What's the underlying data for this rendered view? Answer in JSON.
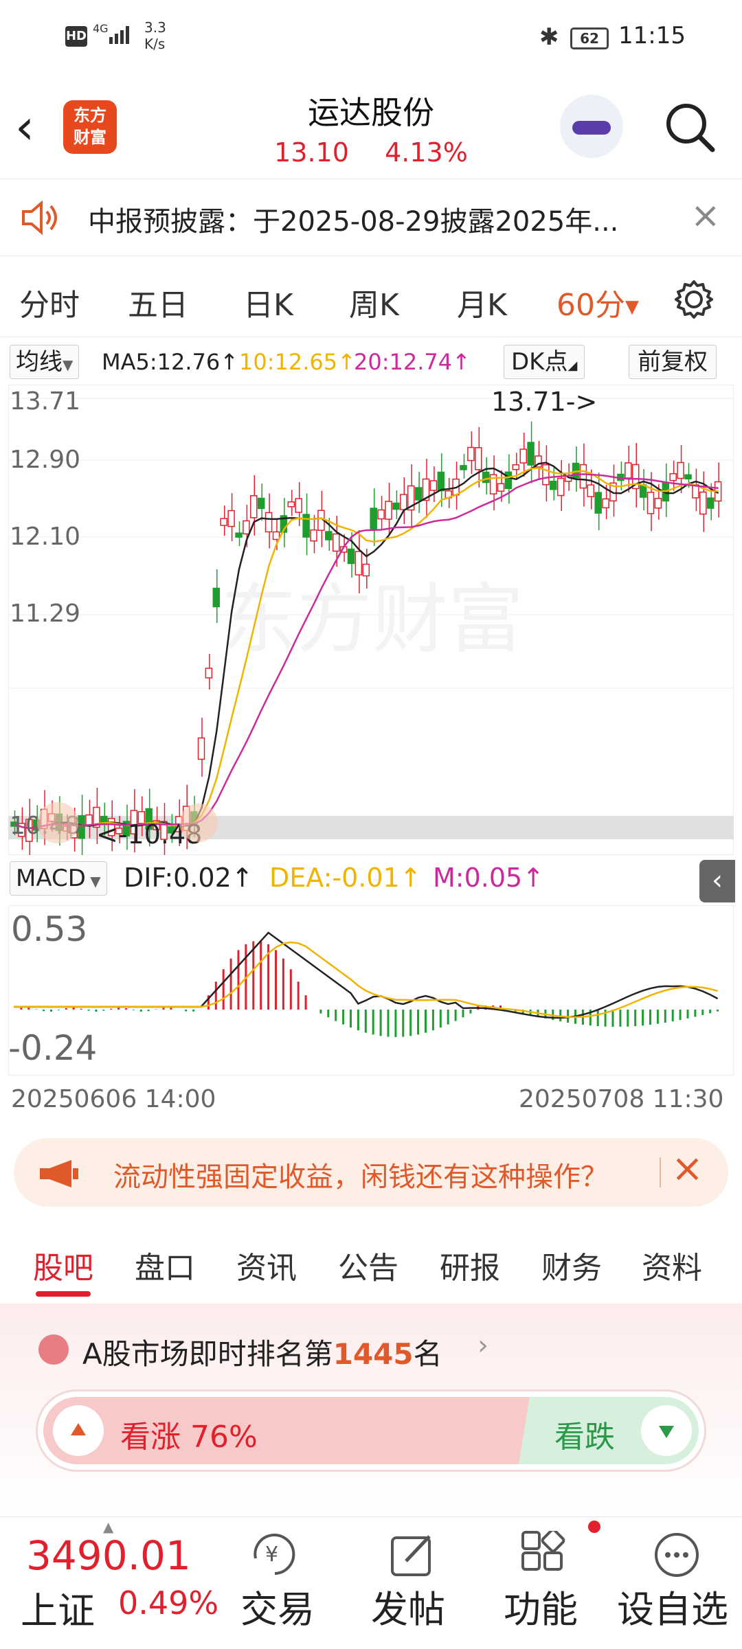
{
  "status_bar": {
    "hd": "HD",
    "network": "4G",
    "speed_value": "3.3",
    "speed_unit": "K/s",
    "battery": "62",
    "time": "11:15"
  },
  "header": {
    "logo_line1": "东方",
    "logo_line2": "财富",
    "title": "运达股份",
    "price": "13.10",
    "change": "4.13%"
  },
  "notice": {
    "text": "中报预披露：于2025-08-29披露2025年..."
  },
  "tabs": [
    "分时",
    "五日",
    "日K",
    "周K",
    "月K",
    "60分"
  ],
  "indicator_bar": {
    "selector": "均线",
    "ma5": "MA5:12.76↑",
    "ma10": "10:12.65↑",
    "ma20": "20:12.74↑",
    "dk": "DK点",
    "fq": "前复权"
  },
  "price_axis": [
    "13.71",
    "12.90",
    "12.10",
    "11.29",
    "10.48"
  ],
  "annotations": {
    "high": "13.71->",
    "low": "<-10.48"
  },
  "watermark": "东方财富",
  "macd_bar": {
    "selector": "MACD",
    "dif": "DIF:0.02↑",
    "dea": "DEA:-0.01↑",
    "m": "M:0.05↑"
  },
  "macd_axis": [
    "0.53",
    "-0.24"
  ],
  "date_range": {
    "start": "20250606 14:00",
    "end": "20250708 11:30"
  },
  "colors": {
    "up": "#e0202d",
    "down": "#1f9e2f",
    "ma5": "#222222",
    "ma10": "#f0b400",
    "ma20": "#cc2a9b",
    "accent": "#e0592a"
  },
  "ad": {
    "text": "流动性强固定收益，闲钱还有这种操作？"
  },
  "bottom_tabs": [
    "股吧",
    "盘口",
    "资讯",
    "公告",
    "研报",
    "财务",
    "资料"
  ],
  "ranking": {
    "prefix": "A股市场即时排名第",
    "rank": "1445",
    "suffix": "名"
  },
  "vote": {
    "up": "看涨 76%",
    "down": "看跌",
    "up_fraction": 0.76
  },
  "footer": {
    "index_value": "3490.01",
    "index_name": "上证",
    "index_change": "0.49%",
    "buttons": [
      "交易",
      "发帖",
      "功能",
      "设自选"
    ]
  }
}
